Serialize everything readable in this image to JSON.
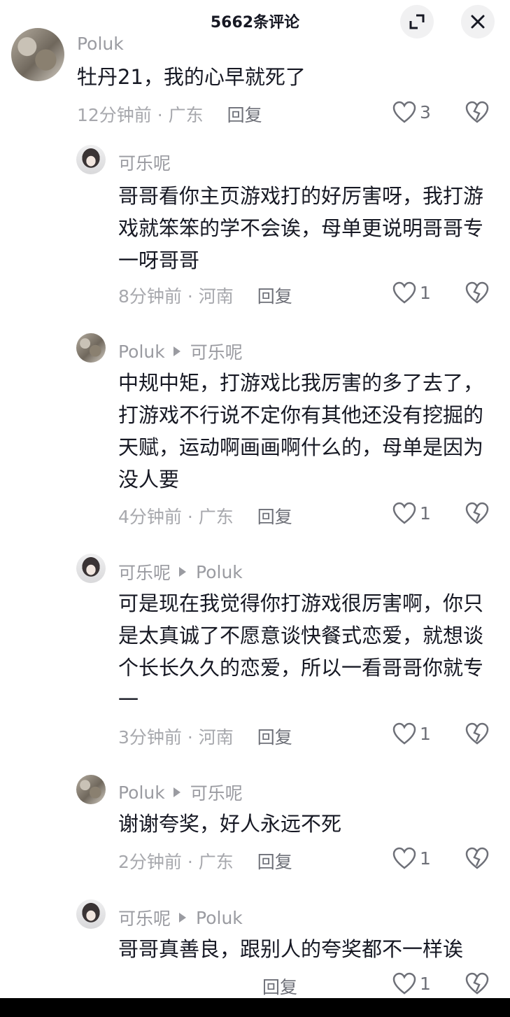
{
  "header": {
    "title": "5662条评论"
  },
  "comments": [
    {
      "user": "Poluk",
      "reply_to": "",
      "text": "牡丹21，我的心早就死了",
      "time": "12分钟前 · 广东",
      "reply_label": "回复",
      "likes": "3"
    },
    {
      "user": "可乐呢",
      "reply_to": "",
      "text": "哥哥看你主页游戏打的好厉害呀，我打游戏就笨笨的学不会诶，母单更说明哥哥专一呀哥哥",
      "time": "8分钟前 · 河南",
      "reply_label": "回复",
      "likes": "1"
    },
    {
      "user": "Poluk",
      "reply_to": "可乐呢",
      "text": "中规中矩，打游戏比我厉害的多了去了，打游戏不行说不定你有其他还没有挖掘的天赋，运动啊画画啊什么的，母单是因为没人要",
      "time": "4分钟前 · 广东",
      "reply_label": "回复",
      "likes": "1"
    },
    {
      "user": "可乐呢",
      "reply_to": "Poluk",
      "text": "可是现在我觉得你打游戏很厉害啊，你只是太真诚了不愿意谈快餐式恋爱，就想谈个长长久久的恋爱，所以一看哥哥你就专一",
      "time": "3分钟前 · 河南",
      "reply_label": "回复",
      "likes": "1"
    },
    {
      "user": "Poluk",
      "reply_to": "可乐呢",
      "text": "谢谢夸奖，好人永远不死",
      "time": "2分钟前 · 广东",
      "reply_label": "回复",
      "likes": "1"
    },
    {
      "user": "可乐呢",
      "reply_to": "Poluk",
      "text": "哥哥真善良，跟别人的夸奖都不一样诶",
      "time": "",
      "reply_label": "回复",
      "likes": "1"
    }
  ],
  "colors": {
    "text": "#161823",
    "muted": "#9a9ba1",
    "button_bg": "#f1f1f2"
  },
  "icons": [
    "expand-icon",
    "close-icon",
    "heart-icon",
    "dislike-icon",
    "reply-arrow-icon"
  ]
}
